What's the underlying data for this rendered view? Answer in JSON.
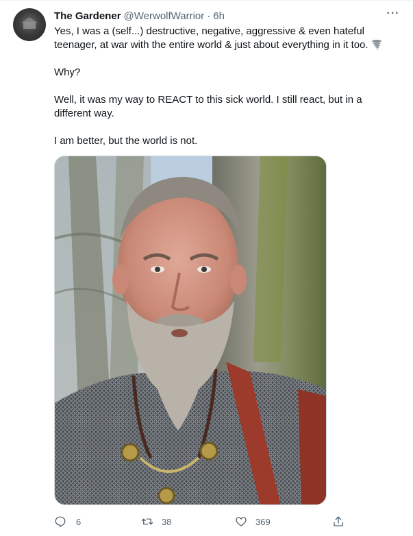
{
  "tweet": {
    "author_name": "The Gardener",
    "author_handle": "@WerwolfWarrior",
    "separator": "·",
    "time": "6h",
    "more_label": "···",
    "paragraphs": [
      "Yes, I was a (self...) destructive, negative, aggressive & even hateful teenager, at war with the entire world & just about everything in it too.",
      "Why?",
      "Well, it was my way to REACT to this sick world. I still react, but in a different way.",
      "I am better, but the world is not."
    ],
    "emoji": "tornado-icon",
    "media": {
      "type": "photo",
      "description_icon": "photo-man-chainmail"
    }
  },
  "actions": {
    "reply_count": "6",
    "retweet_count": "38",
    "like_count": "369"
  },
  "colors": {
    "text": "#0f1419",
    "secondary": "#536471",
    "border": "#cfd9de"
  }
}
